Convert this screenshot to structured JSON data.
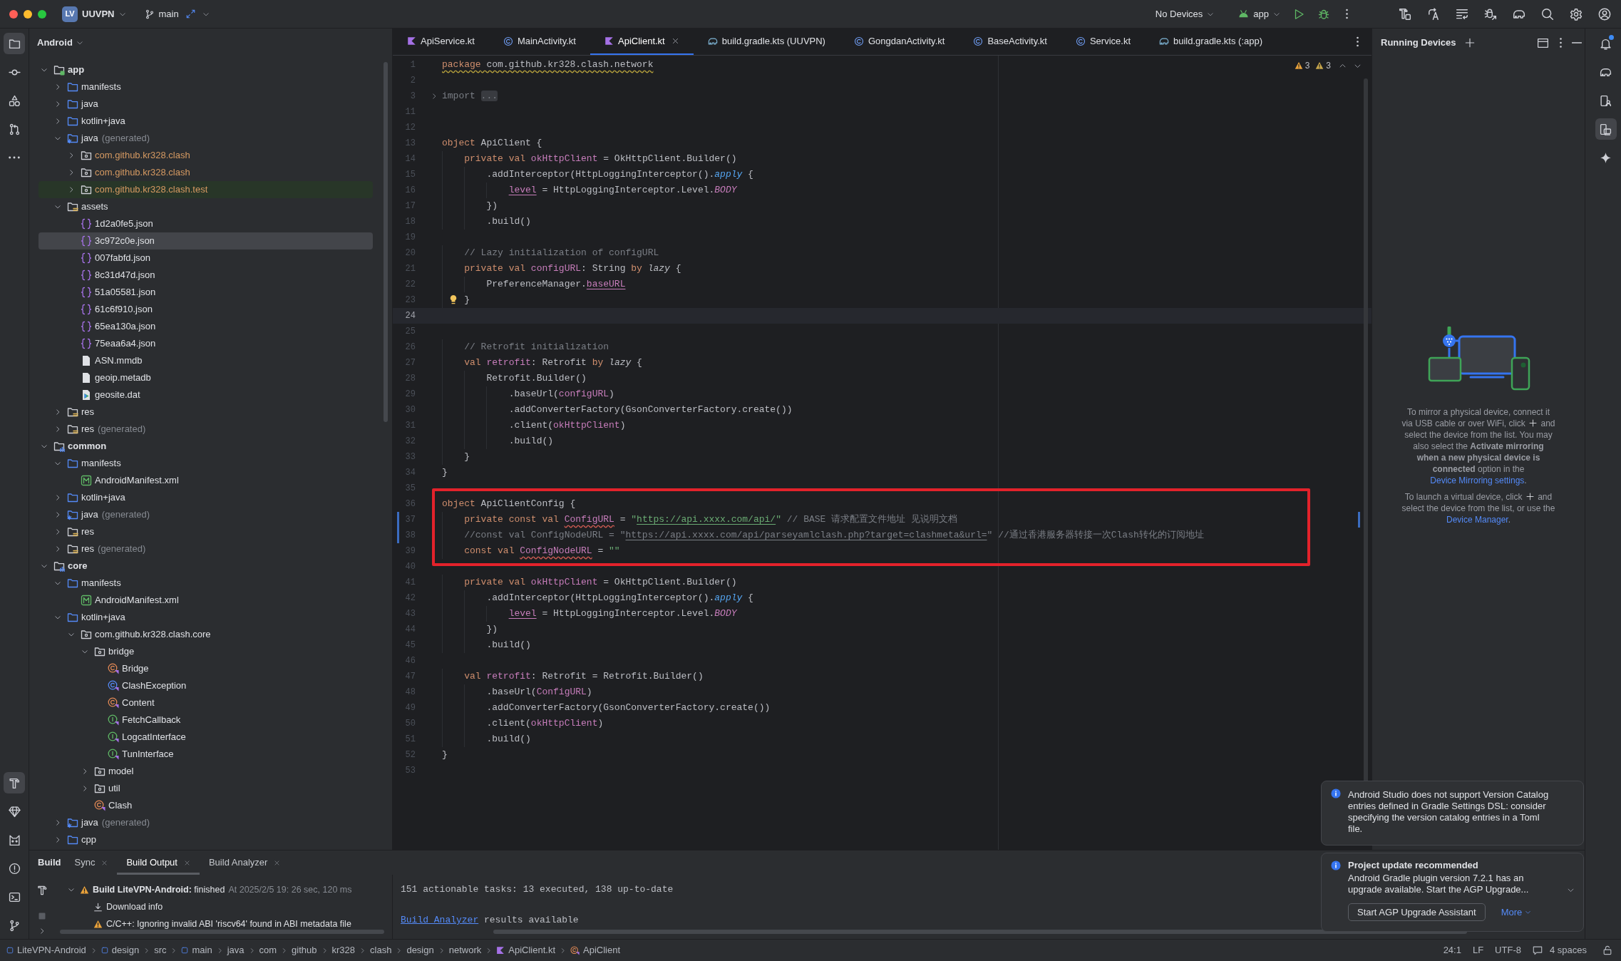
{
  "title_bar": {
    "project_badge": "LV",
    "project": "UUVPN",
    "branch": "main",
    "device_selector": "No Devices",
    "run_configuration": "app"
  },
  "left_tool_strip": {
    "top": [
      {
        "kind": "project",
        "selected": true
      },
      {
        "kind": "commit",
        "selected": false
      },
      {
        "kind": "structure",
        "selected": false
      },
      {
        "kind": "pull-requests",
        "selected": false
      },
      {
        "kind": "more",
        "selected": false
      }
    ],
    "bottom": [
      {
        "kind": "build",
        "selected": true
      },
      {
        "kind": "gem",
        "selected": false
      },
      {
        "kind": "logcat",
        "selected": false
      },
      {
        "kind": "problems",
        "selected": false
      },
      {
        "kind": "terminal",
        "selected": false
      },
      {
        "kind": "git",
        "selected": false
      }
    ]
  },
  "project_panel": {
    "view": "Android",
    "tree": [
      {
        "kind": "app-module",
        "label": "app",
        "expanded": true,
        "selected": false,
        "children": [
          {
            "kind": "folder",
            "label": "manifests",
            "expanded": false,
            "selected": false
          },
          {
            "kind": "folder",
            "label": "java",
            "expanded": false,
            "selected": false
          },
          {
            "kind": "folder",
            "label": "kotlin+java",
            "expanded": false,
            "selected": false
          },
          {
            "kind": "generated-root",
            "label": "java",
            "suffix": "(generated)",
            "expanded": true,
            "selected": false,
            "children": [
              {
                "kind": "generated-package",
                "label": "com.github.kr328.clash",
                "expanded": false,
                "selected": false
              },
              {
                "kind": "generated-package",
                "label": "com.github.kr328.clash",
                "expanded": false,
                "selected": false
              },
              {
                "kind": "generated-test-package",
                "label": "com.github.kr328.clash.test",
                "expanded": false,
                "selected": false
              }
            ]
          },
          {
            "kind": "resources",
            "label": "assets",
            "expanded": true,
            "selected": false,
            "children": [
              {
                "kind": "json",
                "label": "1d2a0fe5.json",
                "selected": false
              },
              {
                "kind": "json",
                "label": "3c972c0e.json",
                "selected": true
              },
              {
                "kind": "json",
                "label": "007fabfd.json",
                "selected": false
              },
              {
                "kind": "json",
                "label": "8c31d47d.json",
                "selected": false
              },
              {
                "kind": "json",
                "label": "51a05581.json",
                "selected": false
              },
              {
                "kind": "json",
                "label": "61c6f910.json",
                "selected": false
              },
              {
                "kind": "json",
                "label": "65ea130a.json",
                "selected": false
              },
              {
                "kind": "json",
                "label": "75eaa6a4.json",
                "selected": false
              },
              {
                "kind": "file",
                "label": "ASN.mmdb",
                "selected": false
              },
              {
                "kind": "file",
                "label": "geoip.metadb",
                "selected": false
              },
              {
                "kind": "geodata",
                "label": "geosite.dat",
                "selected": false
              }
            ]
          },
          {
            "kind": "resources",
            "label": "res",
            "expanded": false,
            "selected": false
          },
          {
            "kind": "resources",
            "label": "res",
            "suffix": "(generated)",
            "expanded": false,
            "selected": false
          }
        ]
      },
      {
        "kind": "library-module",
        "label": "common",
        "expanded": true,
        "selected": false,
        "children": [
          {
            "kind": "folder",
            "label": "manifests",
            "expanded": true,
            "selected": false,
            "children": [
              {
                "kind": "manifest",
                "label": "AndroidManifest.xml",
                "selected": false
              }
            ]
          },
          {
            "kind": "folder",
            "label": "kotlin+java",
            "expanded": false,
            "selected": false
          },
          {
            "kind": "generated-root",
            "label": "java",
            "suffix": "(generated)",
            "expanded": false,
            "selected": false
          },
          {
            "kind": "resources",
            "label": "res",
            "expanded": false,
            "selected": false
          },
          {
            "kind": "resources",
            "label": "res",
            "suffix": "(generated)",
            "expanded": false,
            "selected": false
          }
        ]
      },
      {
        "kind": "library-module",
        "label": "core",
        "expanded": true,
        "selected": false,
        "children": [
          {
            "kind": "folder",
            "label": "manifests",
            "expanded": true,
            "selected": false,
            "children": [
              {
                "kind": "manifest",
                "label": "AndroidManifest.xml",
                "selected": false
              }
            ]
          },
          {
            "kind": "folder",
            "label": "kotlin+java",
            "expanded": true,
            "selected": false,
            "children": [
              {
                "kind": "package",
                "label": "com.github.kr328.clash.core",
                "expanded": true,
                "selected": false,
                "children": [
                  {
                    "kind": "package",
                    "label": "bridge",
                    "expanded": true,
                    "selected": false,
                    "children": [
                      {
                        "kind": "kotlin-class",
                        "label": "Bridge",
                        "selected": false
                      },
                      {
                        "kind": "exception-class",
                        "label": "ClashException",
                        "selected": false
                      },
                      {
                        "kind": "kotlin-class",
                        "label": "Content",
                        "selected": false
                      },
                      {
                        "kind": "interface",
                        "label": "FetchCallback",
                        "selected": false
                      },
                      {
                        "kind": "interface",
                        "label": "LogcatInterface",
                        "selected": false
                      },
                      {
                        "kind": "interface",
                        "label": "TunInterface",
                        "selected": false
                      }
                    ]
                  },
                  {
                    "kind": "package",
                    "label": "model",
                    "expanded": false,
                    "selected": false
                  },
                  {
                    "kind": "package",
                    "label": "util",
                    "expanded": false,
                    "selected": false
                  },
                  {
                    "kind": "kotlin-class",
                    "label": "Clash",
                    "selected": false
                  }
                ]
              }
            ]
          },
          {
            "kind": "generated-root",
            "label": "java",
            "suffix": "(generated)",
            "expanded": false,
            "selected": false
          },
          {
            "kind": "folder",
            "label": "cpp",
            "expanded": false,
            "selected": false
          }
        ]
      }
    ]
  },
  "editor": {
    "tabs": [
      {
        "kind": "kotlin-file",
        "label": "ApiService.kt",
        "selected": false
      },
      {
        "kind": "class",
        "label": "MainActivity.kt",
        "selected": false
      },
      {
        "kind": "kotlin-file",
        "label": "ApiClient.kt",
        "selected": true
      },
      {
        "kind": "gradle",
        "label": "build.gradle.kts (UUVPN)",
        "selected": false
      },
      {
        "kind": "class",
        "label": "GongdanActivity.kt",
        "selected": false
      },
      {
        "kind": "class",
        "label": "BaseActivity.kt",
        "selected": false
      },
      {
        "kind": "class",
        "label": "Service.kt",
        "selected": false
      },
      {
        "kind": "gradle",
        "label": "build.gradle.kts (:app)",
        "selected": false
      }
    ],
    "inspections": {
      "warnings": "3",
      "weak_warnings": "3"
    },
    "blocks": [
      {
        "boxed": false,
        "lines": [
          {
            "number": "1",
            "current": false,
            "changed": false,
            "tokens": [
              {
                "kind": "keyword-warn",
                "text": "package"
              },
              {
                "kind": "plain-warn",
                "text": " com.github.kr328.clash.network"
              }
            ]
          },
          {
            "number": "2",
            "current": false,
            "changed": false
          },
          {
            "number": "3",
            "current": false,
            "changed": false,
            "folded": true,
            "tokens": [
              {
                "kind": "muted",
                "text": "import "
              },
              {
                "kind": "fold",
                "text": "..."
              }
            ]
          },
          {
            "number": "11",
            "current": false,
            "changed": false
          },
          {
            "number": "12",
            "current": false,
            "changed": false
          },
          {
            "number": "13",
            "current": false,
            "changed": false,
            "tokens": [
              {
                "kind": "keyword",
                "text": "object "
              },
              {
                "kind": "plain",
                "text": "ApiClient {"
              }
            ]
          },
          {
            "number": "14",
            "current": false,
            "changed": false,
            "tokens": [
              {
                "kind": "keyword",
                "text": "    private val "
              },
              {
                "kind": "property",
                "text": "okHttpClient"
              },
              {
                "kind": "plain",
                "text": " = OkHttpClient.Builder()"
              }
            ]
          },
          {
            "number": "15",
            "current": false,
            "changed": false,
            "tokens": [
              {
                "kind": "plain",
                "text": "        .addInterceptor(HttpLoggingInterceptor()."
              },
              {
                "kind": "function-italic",
                "text": "apply"
              },
              {
                "kind": "plain",
                "text": " {"
              }
            ]
          },
          {
            "number": "16",
            "current": false,
            "changed": false,
            "tokens": [
              {
                "kind": "property-ref",
                "text": "            level"
              },
              {
                "kind": "plain",
                "text": " = HttpLoggingInterceptor.Level."
              },
              {
                "kind": "constant-italic",
                "text": "BODY"
              }
            ]
          },
          {
            "number": "17",
            "current": false,
            "changed": false,
            "tokens": [
              {
                "kind": "plain",
                "text": "        })"
              }
            ]
          },
          {
            "number": "18",
            "current": false,
            "changed": false,
            "tokens": [
              {
                "kind": "plain",
                "text": "        .build()"
              }
            ]
          },
          {
            "number": "19",
            "current": false,
            "changed": false
          },
          {
            "number": "20",
            "current": false,
            "changed": false,
            "tokens": [
              {
                "kind": "comment",
                "text": "    // Lazy initialization of configURL"
              }
            ]
          },
          {
            "number": "21",
            "current": false,
            "changed": false,
            "tokens": [
              {
                "kind": "keyword",
                "text": "    private val "
              },
              {
                "kind": "property",
                "text": "configURL"
              },
              {
                "kind": "plain",
                "text": ": String "
              },
              {
                "kind": "keyword",
                "text": "by "
              },
              {
                "kind": "italic",
                "text": "lazy"
              },
              {
                "kind": "plain",
                "text": " {"
              }
            ]
          },
          {
            "number": "22",
            "current": false,
            "changed": false,
            "tokens": [
              {
                "kind": "plain",
                "text": "        PreferenceManager."
              },
              {
                "kind": "property-ref",
                "text": "baseURL"
              }
            ]
          },
          {
            "number": "23",
            "current": false,
            "changed": false,
            "bulb": true,
            "tokens": [
              {
                "kind": "plain",
                "text": "    }"
              }
            ]
          },
          {
            "number": "24",
            "current": true,
            "changed": false
          },
          {
            "number": "25",
            "current": false,
            "changed": false
          },
          {
            "number": "26",
            "current": false,
            "changed": false,
            "tokens": [
              {
                "kind": "comment",
                "text": "    // Retrofit initialization"
              }
            ]
          },
          {
            "number": "27",
            "current": false,
            "changed": false,
            "tokens": [
              {
                "kind": "keyword",
                "text": "    val "
              },
              {
                "kind": "property",
                "text": "retrofit"
              },
              {
                "kind": "plain",
                "text": ": Retrofit "
              },
              {
                "kind": "keyword",
                "text": "by "
              },
              {
                "kind": "italic",
                "text": "lazy"
              },
              {
                "kind": "plain",
                "text": " {"
              }
            ]
          },
          {
            "number": "28",
            "current": false,
            "changed": false,
            "tokens": [
              {
                "kind": "plain",
                "text": "        Retrofit.Builder()"
              }
            ]
          },
          {
            "number": "29",
            "current": false,
            "changed": false,
            "tokens": [
              {
                "kind": "plain",
                "text": "            .baseUrl("
              },
              {
                "kind": "property",
                "text": "configURL"
              },
              {
                "kind": "plain",
                "text": ")"
              }
            ]
          },
          {
            "number": "30",
            "current": false,
            "changed": false,
            "tokens": [
              {
                "kind": "plain",
                "text": "            .addConverterFactory(GsonConverterFactory.create())"
              }
            ]
          },
          {
            "number": "31",
            "current": false,
            "changed": false,
            "tokens": [
              {
                "kind": "plain",
                "text": "            .client("
              },
              {
                "kind": "property",
                "text": "okHttpClient"
              },
              {
                "kind": "plain",
                "text": ")"
              }
            ]
          },
          {
            "number": "32",
            "current": false,
            "changed": false,
            "tokens": [
              {
                "kind": "plain",
                "text": "            .build()"
              }
            ]
          },
          {
            "number": "33",
            "current": false,
            "changed": false,
            "tokens": [
              {
                "kind": "plain",
                "text": "    }"
              }
            ]
          },
          {
            "number": "34",
            "current": false,
            "changed": false,
            "tokens": [
              {
                "kind": "plain",
                "text": "}"
              }
            ]
          },
          {
            "number": "35",
            "current": false,
            "changed": false
          }
        ]
      },
      {
        "boxed": true,
        "lines": [
          {
            "number": "36",
            "current": false,
            "changed": false,
            "tokens": [
              {
                "kind": "keyword",
                "text": "object "
              },
              {
                "kind": "plain",
                "text": "ApiClientConfig {"
              }
            ]
          },
          {
            "number": "37",
            "current": false,
            "changed": true,
            "tokens": [
              {
                "kind": "keyword",
                "text": "    private const val "
              },
              {
                "kind": "property-warn",
                "text": "ConfigURL"
              },
              {
                "kind": "plain",
                "text": " = "
              },
              {
                "kind": "string",
                "text": "\""
              },
              {
                "kind": "string-link",
                "text": "https://api.xxxx.com/api/"
              },
              {
                "kind": "string",
                "text": "\""
              },
              {
                "kind": "comment",
                "text": " // BASE 请求配置文件地址 见说明文档"
              }
            ]
          },
          {
            "number": "38",
            "current": false,
            "changed": true,
            "tokens": [
              {
                "kind": "comment",
                "text": "    //const val ConfigNodeURL = \""
              },
              {
                "kind": "comment-link",
                "text": "https://api.xxxx.com/api/parseyamlclash.php?target=clashmeta&url="
              },
              {
                "kind": "comment",
                "text": "\" //通过香港服务器转接一次Clash转化的订阅地址"
              }
            ]
          },
          {
            "number": "39",
            "current": false,
            "changed": false,
            "tokens": [
              {
                "kind": "keyword",
                "text": "    const val "
              },
              {
                "kind": "property-warn",
                "text": "ConfigNodeURL"
              },
              {
                "kind": "plain",
                "text": " = "
              },
              {
                "kind": "string",
                "text": "\"\""
              }
            ]
          }
        ]
      },
      {
        "boxed": false,
        "lines": [
          {
            "number": "40",
            "current": false,
            "changed": false
          },
          {
            "number": "41",
            "current": false,
            "changed": false,
            "tokens": [
              {
                "kind": "keyword",
                "text": "    private val "
              },
              {
                "kind": "property",
                "text": "okHttpClient"
              },
              {
                "kind": "plain",
                "text": " = OkHttpClient.Builder()"
              }
            ]
          },
          {
            "number": "42",
            "current": false,
            "changed": false,
            "tokens": [
              {
                "kind": "plain",
                "text": "        .addInterceptor(HttpLoggingInterceptor()."
              },
              {
                "kind": "function-italic",
                "text": "apply"
              },
              {
                "kind": "plain",
                "text": " {"
              }
            ]
          },
          {
            "number": "43",
            "current": false,
            "changed": false,
            "tokens": [
              {
                "kind": "property-ref",
                "text": "            level"
              },
              {
                "kind": "plain",
                "text": " = HttpLoggingInterceptor.Level."
              },
              {
                "kind": "constant-italic",
                "text": "BODY"
              }
            ]
          },
          {
            "number": "44",
            "current": false,
            "changed": false,
            "tokens": [
              {
                "kind": "plain",
                "text": "        })"
              }
            ]
          },
          {
            "number": "45",
            "current": false,
            "changed": false,
            "tokens": [
              {
                "kind": "plain",
                "text": "        .build()"
              }
            ]
          },
          {
            "number": "46",
            "current": false,
            "changed": false
          },
          {
            "number": "47",
            "current": false,
            "changed": false,
            "tokens": [
              {
                "kind": "keyword",
                "text": "    val "
              },
              {
                "kind": "property",
                "text": "retrofit"
              },
              {
                "kind": "plain",
                "text": ": Retrofit = Retrofit.Builder()"
              }
            ]
          },
          {
            "number": "48",
            "current": false,
            "changed": false,
            "tokens": [
              {
                "kind": "plain",
                "text": "        .baseUrl("
              },
              {
                "kind": "property",
                "text": "ConfigURL"
              },
              {
                "kind": "plain",
                "text": ")"
              }
            ]
          },
          {
            "number": "49",
            "current": false,
            "changed": false,
            "tokens": [
              {
                "kind": "plain",
                "text": "        .addConverterFactory(GsonConverterFactory.create())"
              }
            ]
          },
          {
            "number": "50",
            "current": false,
            "changed": false,
            "tokens": [
              {
                "kind": "plain",
                "text": "        .client("
              },
              {
                "kind": "property",
                "text": "okHttpClient"
              },
              {
                "kind": "plain",
                "text": ")"
              }
            ]
          },
          {
            "number": "51",
            "current": false,
            "changed": false,
            "tokens": [
              {
                "kind": "plain",
                "text": "        .build()"
              }
            ]
          },
          {
            "number": "52",
            "current": false,
            "changed": false,
            "tokens": [
              {
                "kind": "plain",
                "text": "}"
              }
            ]
          },
          {
            "number": "53",
            "current": false,
            "changed": false
          }
        ]
      }
    ]
  },
  "running_devices": {
    "title": "Running Devices",
    "paragraphs": [
      {
        "parts": [
          {
            "kind": "text",
            "text": "To mirror a physical device, connect it via USB cable or over WiFi, click "
          },
          {
            "kind": "plus"
          },
          {
            "kind": "text",
            "text": " and select the device from the list. You may also select the **Activate mirroring when a new physical device is connected** option in the "
          },
          {
            "kind": "link",
            "text": "Device Mirroring settings"
          },
          {
            "kind": "text",
            "text": "."
          }
        ]
      },
      {
        "parts": [
          {
            "kind": "text",
            "text": "To launch a virtual device, click "
          },
          {
            "kind": "plus"
          },
          {
            "kind": "text",
            "text": " and select the device from the list, or use the "
          },
          {
            "kind": "link",
            "text": "Device Manager"
          },
          {
            "kind": "text",
            "text": "."
          }
        ]
      }
    ]
  },
  "right_tool_strip": [
    {
      "kind": "notifications",
      "selected": false,
      "unread": true
    },
    {
      "kind": "gradle",
      "selected": false
    },
    {
      "kind": "device-manager",
      "selected": false
    },
    {
      "kind": "running-devices",
      "selected": true
    },
    {
      "kind": "sparkle",
      "selected": false
    }
  ],
  "notifications": [
    {
      "kind": "info",
      "text": "Android Studio does not support Version Catalog entries defined in Gradle Settings DSL: consider specifying the version catalog entries in a Toml file."
    },
    {
      "kind": "info",
      "title": "Project update recommended",
      "text": "Android Gradle plugin version 7.2.1 has an upgrade available. Start the AGP Upgrade...",
      "expanded": false,
      "actions": [
        {
          "kind": "button",
          "label": "Start AGP Upgrade Assistant"
        },
        {
          "kind": "dropdown-link",
          "label": "More"
        }
      ]
    }
  ],
  "build_panel": {
    "title": "Build",
    "tabs": [
      {
        "label": "Sync",
        "selected": false
      },
      {
        "label": "Build Output",
        "selected": true
      },
      {
        "label": "Build Analyzer",
        "selected": false
      }
    ],
    "tree": [
      {
        "kind": "warning",
        "label": "**Build LiteVPN-Android:** finished",
        "detail": "At 2025/2/5 19: 26 sec, 120 ms",
        "expanded": true,
        "children": [
          {
            "kind": "download",
            "label": "Download info"
          },
          {
            "kind": "warning",
            "label": "C/C++: Ignoring invalid ABI 'riscv64' found in ABI metadata file"
          }
        ]
      }
    ],
    "console": [
      {
        "parts": [
          {
            "kind": "text",
            "text": "151 actionable tasks: 13 executed, 138 up-to-date"
          }
        ]
      },
      {
        "parts": [
          {
            "kind": "link",
            "text": "Build Analyzer"
          },
          {
            "kind": "text",
            "text": " results available"
          }
        ]
      }
    ]
  },
  "status_bar": {
    "breadcrumbs": [
      {
        "kind": "module",
        "label": "LiteVPN-Android"
      },
      {
        "kind": "module",
        "label": "design"
      },
      {
        "kind": "plain",
        "label": "src"
      },
      {
        "kind": "module",
        "label": "main"
      },
      {
        "kind": "plain",
        "label": "java"
      },
      {
        "kind": "plain",
        "label": "com"
      },
      {
        "kind": "plain",
        "label": "github"
      },
      {
        "kind": "plain",
        "label": "kr328"
      },
      {
        "kind": "plain",
        "label": "clash"
      },
      {
        "kind": "plain",
        "label": "design"
      },
      {
        "kind": "plain",
        "label": "network"
      },
      {
        "kind": "kotlin-file",
        "label": "ApiClient.kt"
      },
      {
        "kind": "class",
        "label": "ApiClient"
      }
    ],
    "caret": "24:1",
    "line_separator": "LF",
    "encoding": "UTF-8",
    "indentation": "4 spaces"
  }
}
